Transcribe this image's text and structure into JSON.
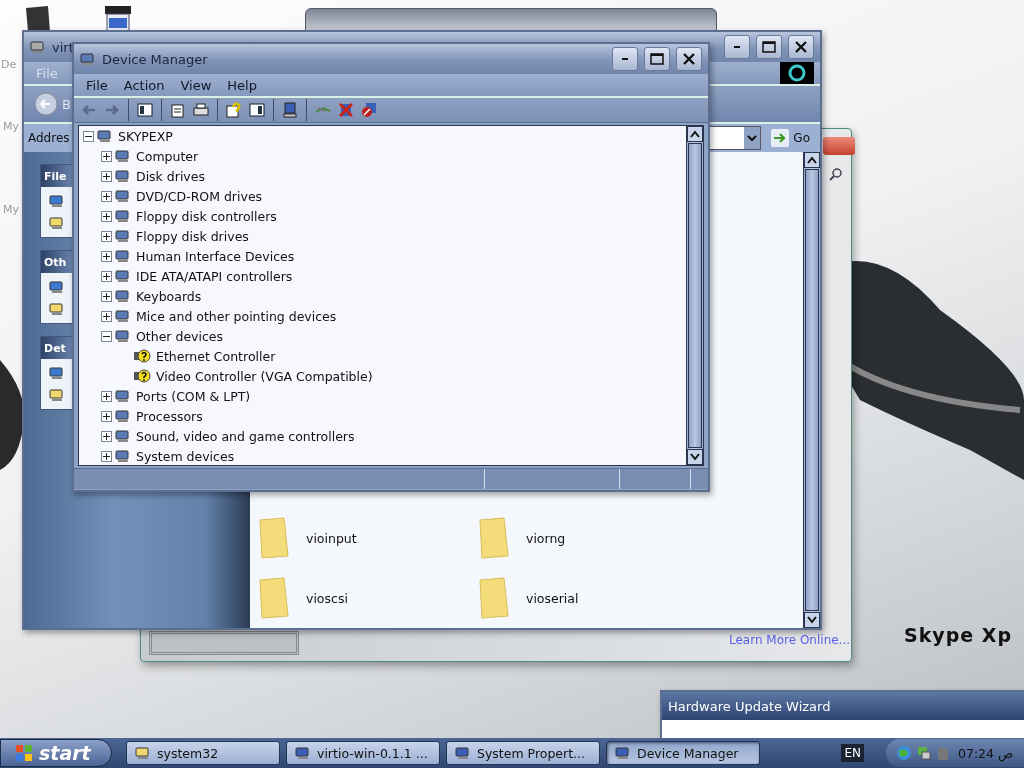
{
  "desktop": {
    "icons": [
      {
        "label": "De"
      },
      {
        "label": "My"
      },
      {
        "label": "My"
      }
    ],
    "brand_text": "Skype Xp"
  },
  "back_window": {
    "link": "Learn More Online..."
  },
  "explorer": {
    "title": "virt",
    "menu": [
      "File"
    ],
    "back_label": "B",
    "address_label": "Addres",
    "go_label": "Go",
    "task_groups": [
      {
        "title": "File"
      },
      {
        "title": "Oth"
      },
      {
        "title": "Det"
      }
    ],
    "folders": [
      {
        "name": "vioinput"
      },
      {
        "name": "viorng"
      },
      {
        "name": "vioscsi"
      },
      {
        "name": "vioserial"
      }
    ]
  },
  "device_manager": {
    "title": "Device Manager",
    "menu": [
      "File",
      "Action",
      "View",
      "Help"
    ],
    "tree": {
      "label": "SKYPEXP",
      "expanded": true,
      "children": [
        {
          "label": "Computer",
          "expanded": false
        },
        {
          "label": "Disk drives",
          "expanded": false
        },
        {
          "label": "DVD/CD-ROM drives",
          "expanded": false
        },
        {
          "label": "Floppy disk controllers",
          "expanded": false
        },
        {
          "label": "Floppy disk drives",
          "expanded": false
        },
        {
          "label": "Human Interface Devices",
          "expanded": false
        },
        {
          "label": "IDE ATA/ATAPI controllers",
          "expanded": false
        },
        {
          "label": "Keyboards",
          "expanded": false
        },
        {
          "label": "Mice and other pointing devices",
          "expanded": false
        },
        {
          "label": "Other devices",
          "expanded": true,
          "children": [
            {
              "label": "Ethernet Controller",
              "problem": true
            },
            {
              "label": "Video Controller (VGA Compatible)",
              "problem": true
            }
          ]
        },
        {
          "label": "Ports (COM & LPT)",
          "expanded": false
        },
        {
          "label": "Processors",
          "expanded": false
        },
        {
          "label": "Sound, video and game controllers",
          "expanded": false
        },
        {
          "label": "System devices",
          "expanded": false
        }
      ]
    }
  },
  "wizard": {
    "title": "Hardware Update Wizard"
  },
  "taskbar": {
    "start": "start",
    "tasks": [
      {
        "label": "system32",
        "selected": false
      },
      {
        "label": "virtio-win-0.1.1 ...",
        "selected": false
      },
      {
        "label": "System Propert...",
        "selected": false
      },
      {
        "label": "Device Manager",
        "selected": true
      }
    ],
    "language": "EN",
    "clock": "07:24 ص"
  }
}
